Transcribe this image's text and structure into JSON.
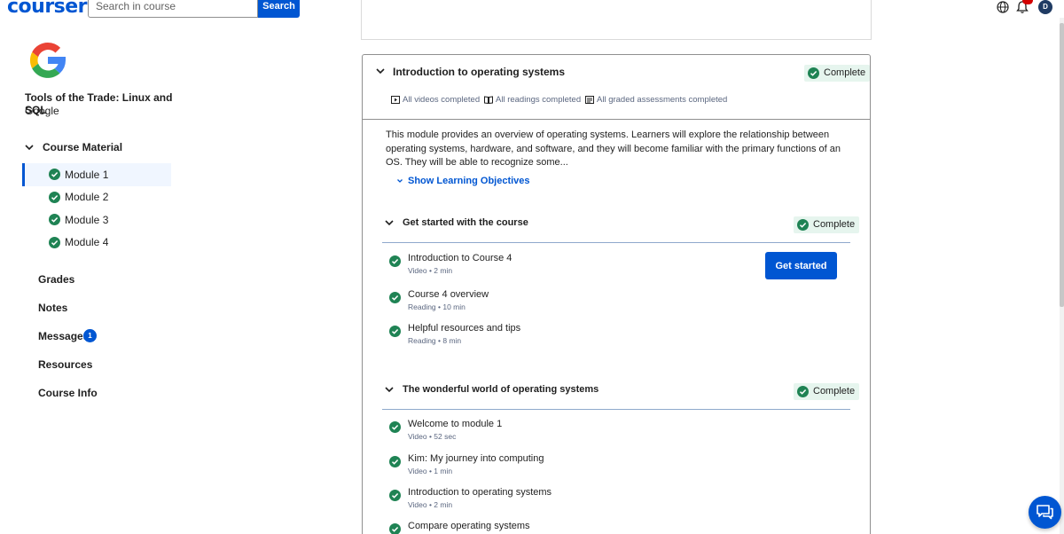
{
  "header": {
    "logo_text": "coursera",
    "search_placeholder": "Search in course",
    "search_button": "Search",
    "avatar_initial": "D",
    "brand_color": "#0056d2"
  },
  "sidebar": {
    "course_title": "Tools of the Trade: Linux and SQL",
    "partner": "Google",
    "course_material_label": "Course Material",
    "modules": [
      {
        "label": "Module 1",
        "active": true,
        "completed": true
      },
      {
        "label": "Module 2",
        "active": false,
        "completed": true
      },
      {
        "label": "Module 3",
        "active": false,
        "completed": true
      },
      {
        "label": "Module 4",
        "active": false,
        "completed": true
      }
    ],
    "links": {
      "grades": "Grades",
      "notes": "Notes",
      "messages": "Messages",
      "messages_count": "1",
      "resources": "Resources",
      "course_info": "Course Info"
    }
  },
  "module": {
    "title": "Introduction to operating systems",
    "status": "Complete",
    "summary": {
      "videos": "All videos completed",
      "readings": "All readings completed",
      "assessments": "All graded assessments completed"
    },
    "description": "This module provides an overview of operating systems. Learners will explore the relationship between operating systems, hardware, and software, and they will become familiar with the primary functions of an OS. They will be able to recognize some...",
    "objectives_link": "Show Learning Objectives",
    "lessons": [
      {
        "title": "Get started with the course",
        "status": "Complete",
        "action": "Get started",
        "items": [
          {
            "title": "Introduction to Course 4",
            "meta": "Video • 2 min"
          },
          {
            "title": "Course 4 overview",
            "meta": "Reading • 10 min"
          },
          {
            "title": "Helpful resources and tips",
            "meta": "Reading • 8 min"
          }
        ]
      },
      {
        "title": "The wonderful world of operating systems",
        "status": "Complete",
        "items": [
          {
            "title": "Welcome to module 1",
            "meta": "Video • 52 sec"
          },
          {
            "title": "Kim: My journey into computing",
            "meta": "Video • 1 min"
          },
          {
            "title": "Introduction to operating systems",
            "meta": "Video • 2 min"
          },
          {
            "title": "Compare operating systems",
            "meta": ""
          }
        ]
      }
    ]
  },
  "colors": {
    "complete_green": "#1f8354",
    "complete_bg": "#e6f5ee",
    "notification_red": "#d30001"
  }
}
